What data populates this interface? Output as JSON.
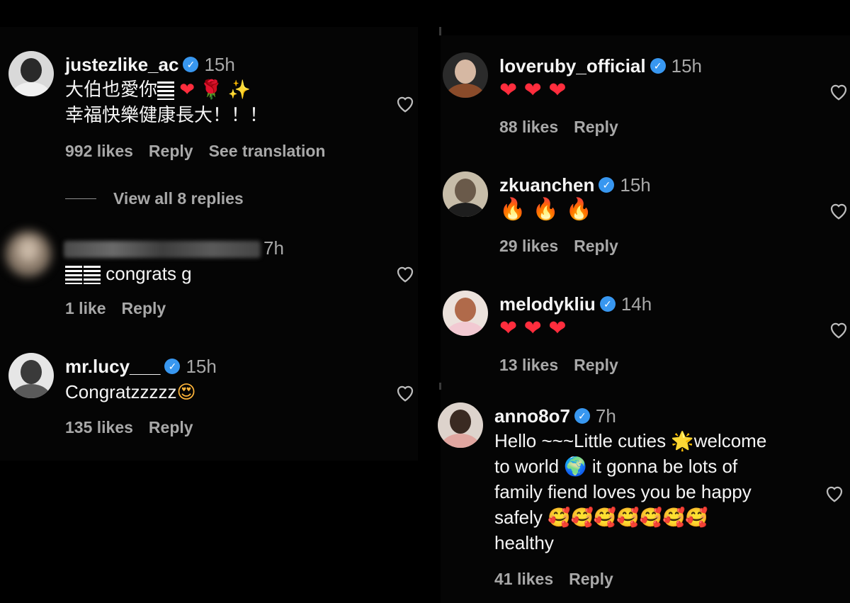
{
  "colors": {
    "background": "#000000",
    "text": "#f5f5f5",
    "muted": "#a8a8a8",
    "verified": "#3897f0",
    "heart_emoji": "#ff2d3d"
  },
  "left_column": {
    "comments": [
      {
        "username": "justezlike_ac",
        "verified": true,
        "time": "15h",
        "lines": [
          "大伯也愛你",
          "幸福快樂健康長大！！！"
        ],
        "emoji_line1": [
          "❤",
          "🌹",
          "✨"
        ],
        "likes": "992 likes",
        "reply": "Reply",
        "translate": "See translation",
        "view_replies": "View all 8 replies"
      },
      {
        "username_hidden": true,
        "time": "7h",
        "text": "congrats g",
        "likes": "1 like",
        "reply": "Reply"
      },
      {
        "username": "mr.lucy___",
        "verified": true,
        "time": "15h",
        "text": "Congratzzzzz",
        "emoji": "😍",
        "likes": "135 likes",
        "reply": "Reply"
      }
    ]
  },
  "right_column": {
    "comments": [
      {
        "username": "loveruby_official",
        "verified": true,
        "time": "15h",
        "emojis": "❤ ❤ ❤",
        "likes": "88 likes",
        "reply": "Reply"
      },
      {
        "username": "zkuanchen",
        "verified": true,
        "time": "15h",
        "emojis": "🔥 🔥 🔥",
        "likes": "29 likes",
        "reply": "Reply"
      },
      {
        "username": "melodykliu",
        "verified": true,
        "time": "14h",
        "emojis": "❤ ❤ ❤",
        "likes": "13 likes",
        "reply": "Reply"
      },
      {
        "username": "anno8o7",
        "verified": true,
        "time": "7h",
        "lines": [
          "Hello ~~~Little cuties",
          "welcome",
          "to world",
          "it gonna be lots of",
          "family fiend loves you be happy",
          "safely",
          "healthy"
        ],
        "emoji_star": "🌟",
        "emoji_globe": "🌍",
        "emoji_hearts": "🥰🥰🥰🥰🥰🥰🥰",
        "likes": "41 likes",
        "reply": "Reply"
      }
    ]
  },
  "icons": {
    "heart": "heart-outline-icon",
    "verified": "verified-badge-icon"
  }
}
